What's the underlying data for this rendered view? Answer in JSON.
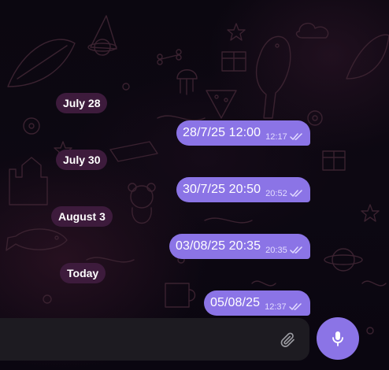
{
  "chat": {
    "messages": [
      {
        "date_label": "July 28",
        "text": "28/7/25 12:00",
        "time": "12:17",
        "status": "read"
      },
      {
        "date_label": "July 30",
        "text": "30/7/25 20:50",
        "time": "20:52",
        "status": "read"
      },
      {
        "date_label": "August 3",
        "text": "03/08/25 20:35",
        "time": "20:35",
        "status": "read"
      },
      {
        "date_label": "Today",
        "text": "05/08/25",
        "time": "12:37",
        "status": "read"
      }
    ]
  },
  "composer": {
    "input_value": "",
    "placeholder": "",
    "attach_icon": "paperclip-icon",
    "mic_icon": "microphone-icon"
  },
  "colors": {
    "bubble": "#8b74e6",
    "date_pill": "#3d1b3c",
    "composer": "#1d1b21",
    "mic_button": "#8b74e6"
  }
}
